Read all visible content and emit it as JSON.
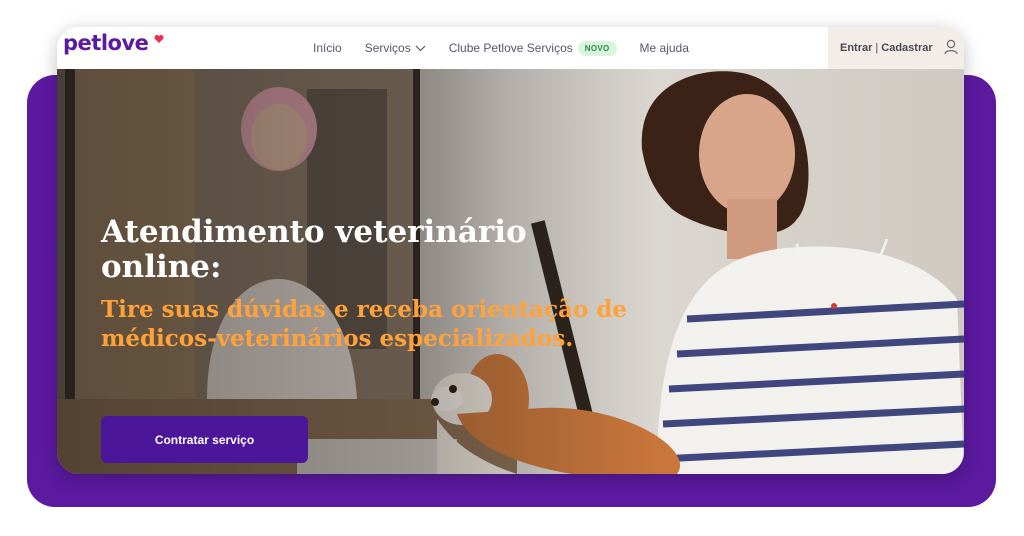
{
  "brand": {
    "logo_text": "petlove",
    "accent_color": "#5b1aa0",
    "heart_color": "#e8304d"
  },
  "nav": {
    "items": [
      {
        "label": "Início"
      },
      {
        "label": "Serviços",
        "has_dropdown": true,
        "icon": "chevron-down-icon"
      },
      {
        "label": "Clube Petlove Serviços",
        "badge": "NOVO"
      },
      {
        "label": "Me ajuda"
      }
    ]
  },
  "account": {
    "login": "Entrar",
    "separator": "|",
    "signup": "Cadastrar",
    "icon": "user-icon"
  },
  "hero": {
    "title": "Atendimento veterinário online:",
    "subtitle": "Tire suas dúvidas e receba orientação de médicos-veterinários especializados.",
    "cta_label": "Contratar serviço",
    "title_color": "#ffffff",
    "subtitle_color": "#ffa23a",
    "cta_color": "#4b169a"
  }
}
